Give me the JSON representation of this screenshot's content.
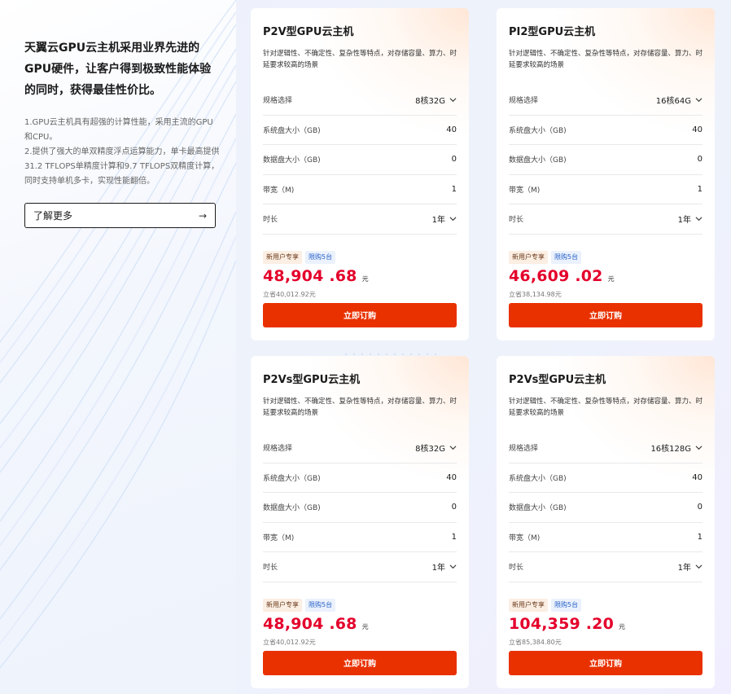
{
  "intro": {
    "title": "天翼云GPU云主机采用业界先进的GPU硬件，让客户得到极致性能体验的同时，获得最佳性价比。",
    "desc_1": "1.GPU云主机具有超强的计算性能，采用主流的GPU和CPU。",
    "desc_2": "2.提供了强大的单双精度浮点运算能力，单卡最高提供31.2 TFLOPS单精度计算和9.7 TFLOPS双精度计算，同时支持单机多卡，实现性能翻倍。",
    "learn_more": "了解更多",
    "arrow": "→"
  },
  "common": {
    "desc": "针对逻辑性、不确定性、复杂性等特点，对存储容量、算力、时延要求较高的场景",
    "spec_label": "规格选择",
    "disk_label": "系统盘大小（GB)",
    "data_disk_label": "数据盘大小（GB)",
    "bandwidth_label": "带宽（M)",
    "duration_label": "时长",
    "badge_new": "新用户专享",
    "badge_limit": "限购5台",
    "unit": "元",
    "buy": "立即订购"
  },
  "cards": [
    {
      "title": "P2V型GPU云主机",
      "spec": "8核32G",
      "disk": "40",
      "data_disk": "0",
      "bandwidth": "1",
      "duration": "1年",
      "price": "48,904 .68",
      "save": "立省40,012.92元"
    },
    {
      "title": "PI2型GPU云主机",
      "spec": "16核64G",
      "disk": "40",
      "data_disk": "0",
      "bandwidth": "1",
      "duration": "1年",
      "price": "46,609 .02",
      "save": "立省38,134.98元"
    },
    {
      "title": "P2Vs型GPU云主机",
      "spec": "8核32G",
      "disk": "40",
      "data_disk": "0",
      "bandwidth": "1",
      "duration": "1年",
      "price": "48,904 .68",
      "save": "立省40,012.92元"
    },
    {
      "title": "P2Vs型GPU云主机",
      "spec": "16核128G",
      "disk": "40",
      "data_disk": "0",
      "bandwidth": "1",
      "duration": "1年",
      "price": "104,359 .20",
      "save": "立省85,384.80元"
    }
  ],
  "colors": {
    "accent": "#e93100",
    "price": "#e4002b"
  }
}
